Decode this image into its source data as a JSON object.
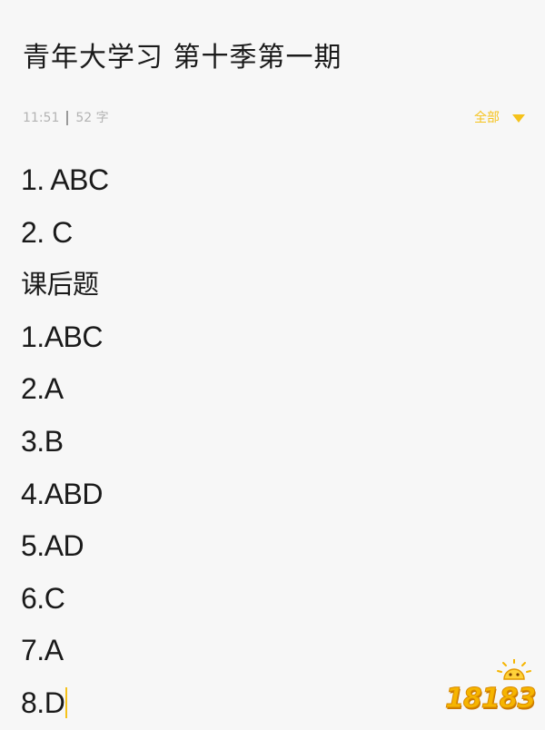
{
  "note": {
    "title": "青年大学习 第十季第一期",
    "time": "11:51",
    "word_count": "52 字",
    "filter_label": "全部",
    "lines": [
      {
        "text": "1. ABC",
        "cjk": false
      },
      {
        "text": "2. C",
        "cjk": false
      },
      {
        "text": "课后题",
        "cjk": true
      },
      {
        "text": "1.ABC",
        "cjk": false
      },
      {
        "text": "2.A",
        "cjk": false
      },
      {
        "text": "3.B",
        "cjk": false
      },
      {
        "text": "4.ABD",
        "cjk": false
      },
      {
        "text": "5.AD",
        "cjk": false
      },
      {
        "text": "6.C",
        "cjk": false
      },
      {
        "text": "7.A",
        "cjk": false
      },
      {
        "text": "8.D",
        "cjk": false
      }
    ]
  },
  "icons": {
    "filter": "chevron-down-icon",
    "cursor": "text-cursor"
  },
  "watermark": {
    "text": "18183"
  },
  "colors": {
    "accent": "#f5c21b",
    "text": "#1a1a1a",
    "meta": "#b3b3b3",
    "background": "#f7f7f7"
  }
}
